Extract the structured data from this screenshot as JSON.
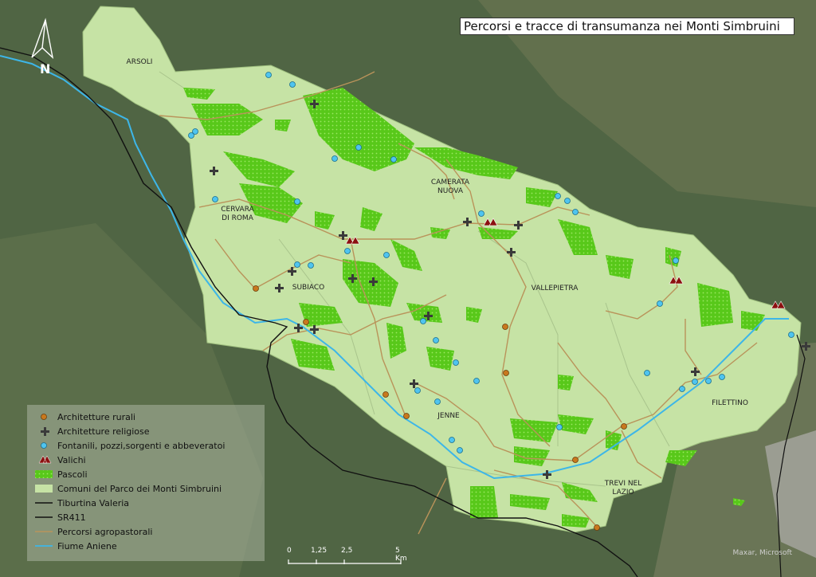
{
  "title": "Percorsi e tracce di transumanza nei Monti Simbruini",
  "north_label": "N",
  "municipalities": [
    {
      "id": "arsoli",
      "label": "ARSOLI"
    },
    {
      "id": "camerata",
      "label": "CAMERATA\nNUOVA"
    },
    {
      "id": "cervara",
      "label": "CERVARA\nDI ROMA"
    },
    {
      "id": "subiaco",
      "label": "SUBIACO"
    },
    {
      "id": "vallepietra",
      "label": "VALLEPIETRA"
    },
    {
      "id": "jenne",
      "label": "JENNE"
    },
    {
      "id": "filettino",
      "label": "FILETTINO"
    },
    {
      "id": "trevi",
      "label": "TREVI NEL\nLAZIO"
    }
  ],
  "legend": {
    "items": [
      {
        "label": "Architetture rurali",
        "symbol": "dot-orange"
      },
      {
        "label": "Architetture religiose",
        "symbol": "cross-dark"
      },
      {
        "label": "Fontanili, pozzi,sorgenti e abbeveratoi",
        "symbol": "dot-cyan"
      },
      {
        "label": "Valichi",
        "symbol": "triangle-red"
      },
      {
        "label": "Pascoli",
        "symbol": "pasture-green"
      },
      {
        "label": "Comuni del Parco dei Monti Simbruini",
        "symbol": "area-lightgreen"
      },
      {
        "label": "Tiburtina Valeria",
        "symbol": "line-black"
      },
      {
        "label": "SR411",
        "symbol": "line-black"
      },
      {
        "label": "Percorsi agropastorali",
        "symbol": "line-tan"
      },
      {
        "label": "Fiume Aniene",
        "symbol": "line-blue"
      }
    ]
  },
  "scale": {
    "labels": [
      "0",
      "1,25",
      "2,5",
      "5 Km"
    ]
  },
  "credit": "Maxar, Microsoft",
  "colors": {
    "park": "#c6e3a5",
    "pasture": "#5fd01e",
    "rural": "#c8781e",
    "religious": "#3a3a3a",
    "water_point": "#4fc4ef",
    "pass": "#8b1010",
    "road": "#111111",
    "path": "#b9935a",
    "river": "#3db6e8"
  }
}
